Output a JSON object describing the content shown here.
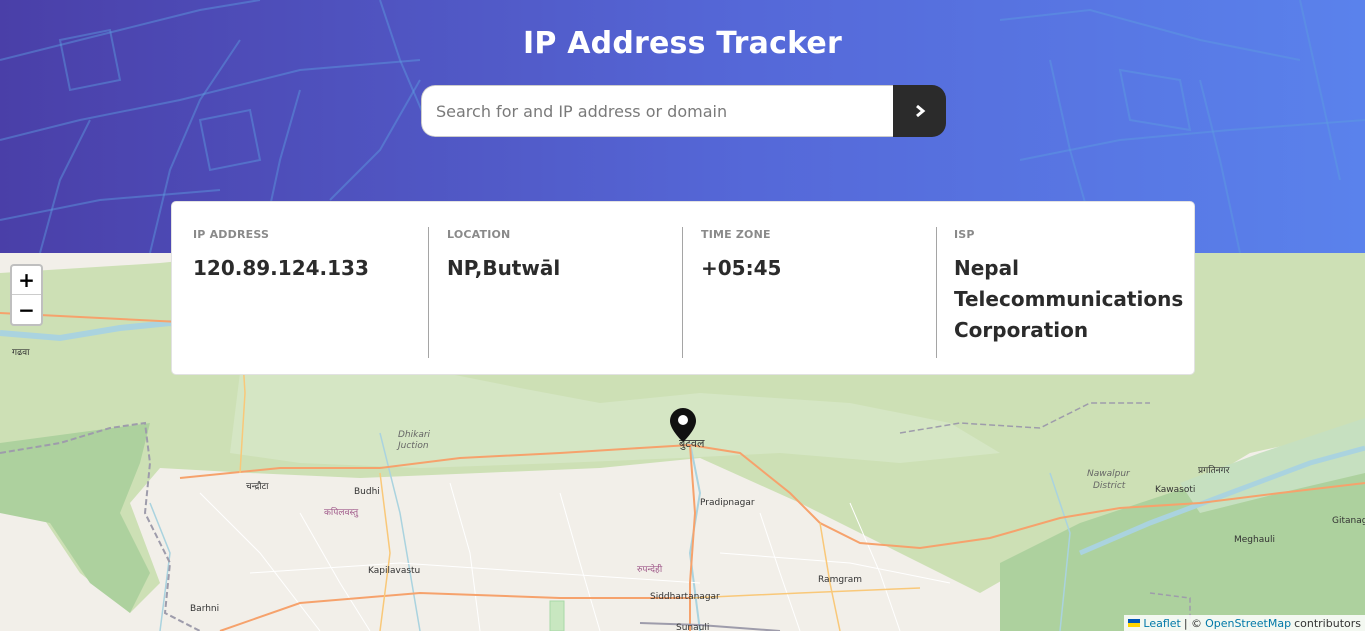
{
  "header": {
    "title": "IP Address Tracker",
    "background_colors": [
      "#4a3fa8",
      "#5a82ec"
    ]
  },
  "search": {
    "placeholder": "Search for and IP address or domain",
    "value": "",
    "button_icon": "chevron-right-icon"
  },
  "info": {
    "ip_label": "IP ADDRESS",
    "ip_value": "120.89.124.133",
    "location_label": "LOCATION",
    "location_value": "NP,Butwāl",
    "timezone_label": "TIME ZONE",
    "timezone_value": "+05:45",
    "isp_label": "ISP",
    "isp_value": "Nepal Telecommunications Corporation"
  },
  "map": {
    "zoom_in": "+",
    "zoom_out": "−",
    "marker_icon": "map-pin-icon",
    "places": {
      "garhwa": "गढवा",
      "butwal": "बुटवल",
      "dhikari_junction_1": "Dhikari",
      "dhikari_junction_2": "Juction",
      "chandrauta": "चन्द्रौटा",
      "budhi": "Budhi",
      "kapilvastu_np": "कपिलवस्तु",
      "pradipnagar": "Pradipnagar",
      "kapilavastu": "Kapilavastu",
      "rupandehi": "रुपन्देही",
      "siddhartanagar": "Siddhartanagar",
      "ramgram": "Ramgram",
      "barhni": "Barhni",
      "sunauli": "Sunauli",
      "nawalpur_1": "Nawalpur",
      "nawalpur_2": "District",
      "pragatinagar": "प्रगतिनगर",
      "kawasoti": "Kawasoti",
      "gitanagar": "Gitanag",
      "meghauli": "Meghauli"
    },
    "attribution": {
      "leaflet": "Leaflet",
      "separator": "| ©",
      "osm": "OpenStreetMap",
      "suffix": "contributors"
    }
  }
}
